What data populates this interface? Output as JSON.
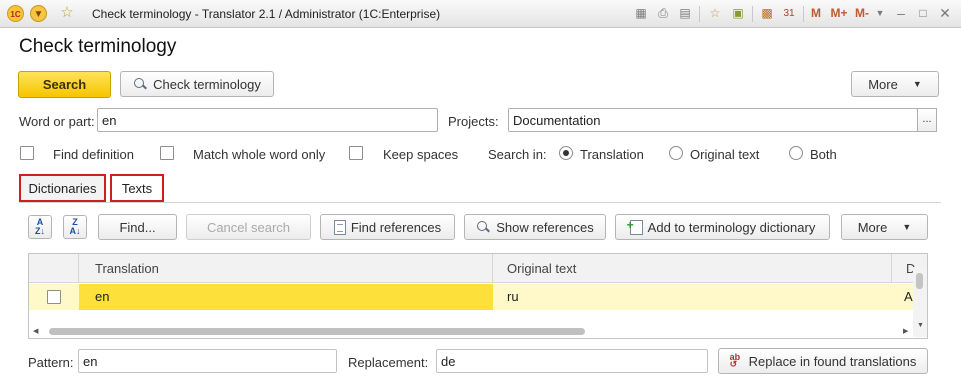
{
  "window": {
    "title": "Check terminology - Translator 2.1 / Administrator  (1C:Enterprise)",
    "logo_text": "1C",
    "toolbar_memory": [
      "M",
      "M+",
      "M-"
    ]
  },
  "page": {
    "title": "Check terminology"
  },
  "command_bar": {
    "search_label": "Search",
    "check_label": "Check terminology",
    "more_label": "More"
  },
  "form": {
    "word_label": "Word or part:",
    "word_value": "en",
    "projects_label": "Projects:",
    "projects_value": "Documentation",
    "projects_button": "..."
  },
  "options": {
    "find_definition": "Find definition",
    "match_whole_word": "Match whole word only",
    "keep_spaces": "Keep spaces",
    "search_in_label": "Search in:",
    "radio_translation": "Translation",
    "radio_original": "Original text",
    "radio_both": "Both",
    "selected": "Translation"
  },
  "tabs": [
    {
      "label": "Dictionaries"
    },
    {
      "label": "Texts"
    }
  ],
  "grid_toolbar": {
    "find_label": "Find...",
    "cancel_label": "Cancel search",
    "find_refs_label": "Find references",
    "show_refs_label": "Show references",
    "add_term_label": "Add to terminology dictionary",
    "more_label": "More"
  },
  "grid": {
    "columns": [
      "Translation",
      "Original text",
      "D"
    ],
    "rows": [
      {
        "translation": "en",
        "original": "ru",
        "extra": "A"
      }
    ]
  },
  "replace": {
    "pattern_label": "Pattern:",
    "pattern_value": "en",
    "replacement_label": "Replacement:",
    "replacement_value": "de",
    "button_label": "Replace in found translations"
  },
  "colors": {
    "accent_yellow": "#f6c400",
    "row_highlight": "#fff8c8",
    "cell_selected": "#fde03a",
    "tab_outline": "#cc1f1f"
  }
}
